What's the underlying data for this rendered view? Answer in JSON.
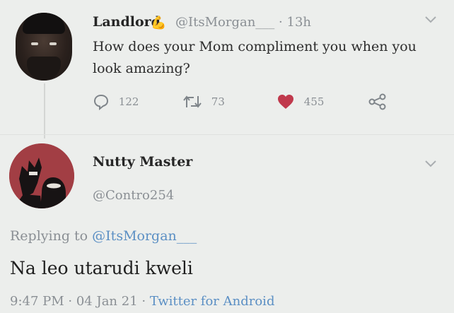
{
  "tweet1": {
    "display_name": "Landlord",
    "name_emoji": "💪",
    "handle": "@ItsMorgan___",
    "time": "· 13h",
    "text": "How does your Mom compliment you when you look amazing?",
    "replies": "122",
    "retweets": "73",
    "likes": "455",
    "like_color": "#c0394c",
    "icons": [
      "reply-icon",
      "retweet-icon",
      "heart-icon",
      "share-icon",
      "chevron-down-icon"
    ]
  },
  "tweet2": {
    "display_name": "Nutty Master",
    "handle": "@Contro254",
    "replying_prefix": "Replying to",
    "replying_to": "@ItsMorgan___",
    "text": "Na leo utarudi kweli",
    "timestamp": "9:47 PM · 04 Jan 21 ·",
    "source": "Twitter for Android",
    "link_color": "#5b8fc4"
  }
}
